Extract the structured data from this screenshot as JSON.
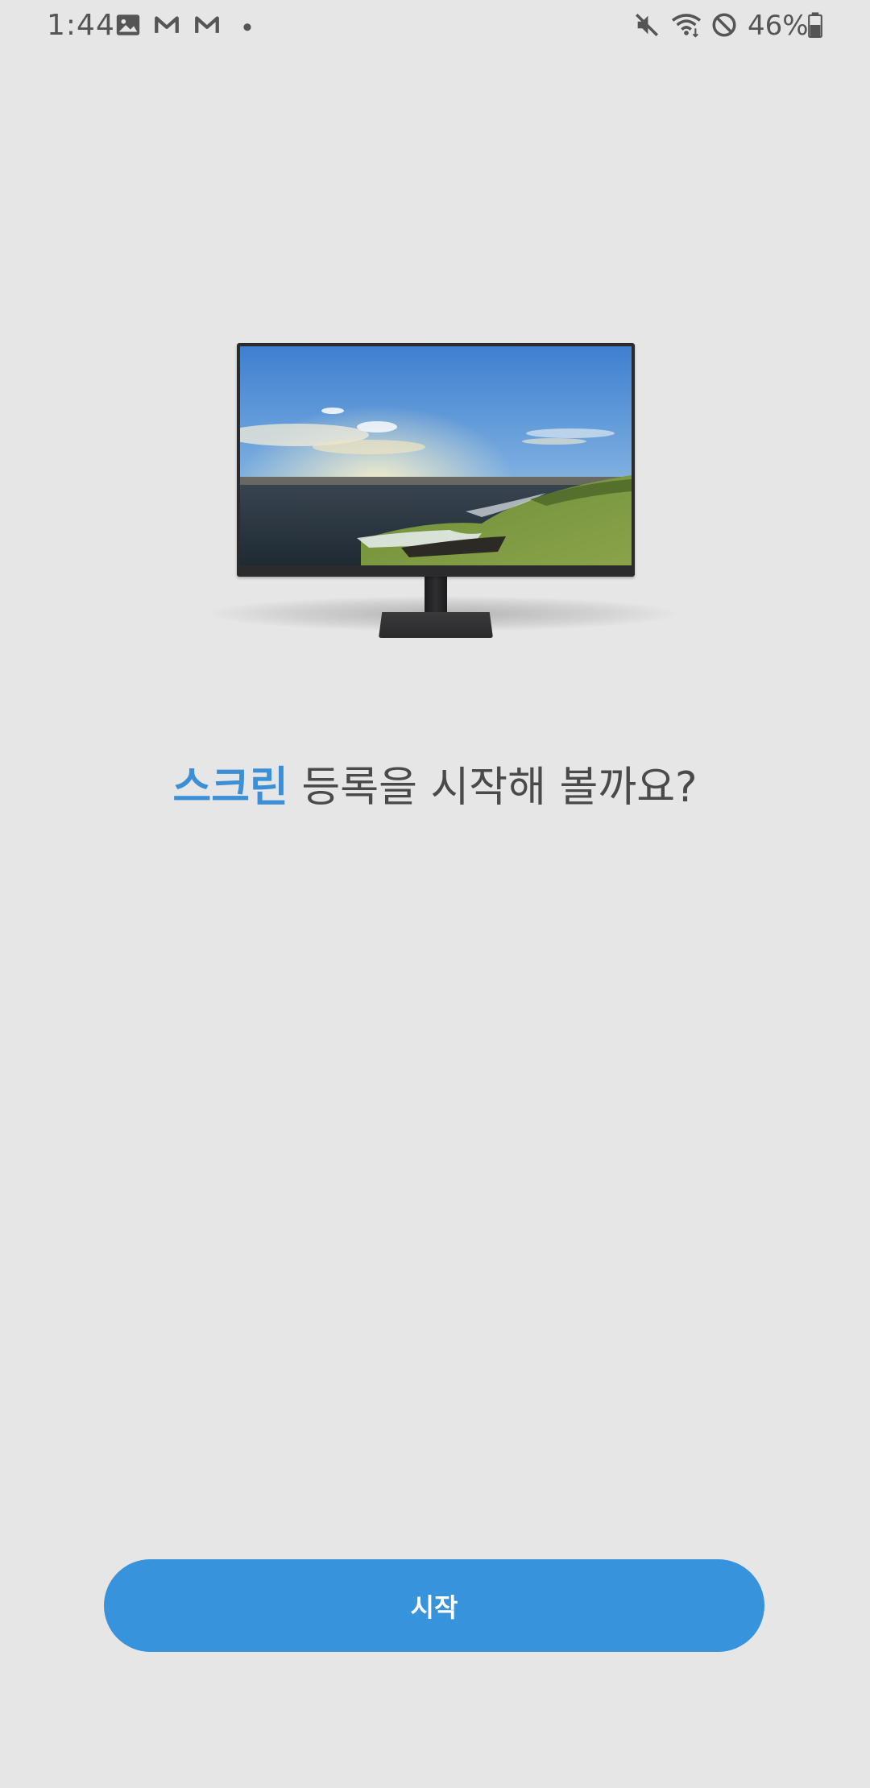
{
  "status_bar": {
    "time": "1:44",
    "battery": "46%",
    "icons": [
      "gallery-icon",
      "gmail-icon",
      "gmail-icon",
      "notification-dot-icon",
      "mute-icon",
      "wifi-icon",
      "do-not-disturb-icon",
      "battery-icon"
    ]
  },
  "headline": {
    "accent": "스크린",
    "rest": " 등록을 시작해 볼까요?"
  },
  "start_button": {
    "label": "시작"
  },
  "colors": {
    "background": "#e6e6e7",
    "accent": "#3a8fd6",
    "button": "#3793dc",
    "button_text": "#ffffff"
  }
}
